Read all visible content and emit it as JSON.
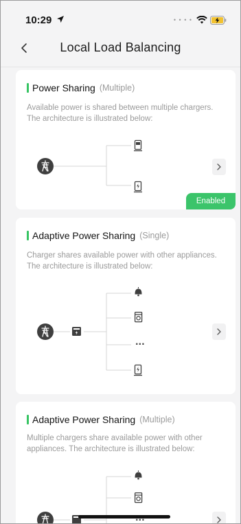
{
  "status_bar": {
    "time": "10:29",
    "icons": [
      "location-arrow-icon",
      "signal-dots-icon",
      "wifi-icon",
      "battery-charging-icon"
    ]
  },
  "nav": {
    "back_icon": "chevron-left-icon",
    "title": "Local Load Balancing"
  },
  "cards": [
    {
      "title": "Power Sharing",
      "subtitle": "(Multiple)",
      "description": "Available power is shared between multiple chargers. The architecture is illustrated below:",
      "badge": "Enabled",
      "diagram_nodes": [
        "grid-tower-icon",
        "charger-icon",
        "charger-icon"
      ]
    },
    {
      "title": "Adaptive Power Sharing",
      "subtitle": "(Single)",
      "description": "Charger shares available power with other appliances. The architecture is illustrated below:",
      "diagram_nodes": [
        "grid-tower-icon",
        "meter-icon",
        "lamp-icon",
        "washing-machine-icon",
        "ellipsis-icon",
        "charger-icon"
      ],
      "ellipsis": "···"
    },
    {
      "title": "Adaptive Power Sharing",
      "subtitle": "(Multiple)",
      "description": "Multiple chargers share available power with other appliances. The architecture is illustrated below:",
      "diagram_nodes": [
        "grid-tower-icon",
        "meter-icon",
        "lamp-icon",
        "washing-machine-icon",
        "ellipsis-icon"
      ],
      "ellipsis": "···"
    }
  ],
  "colors": {
    "accent_green": "#37c463",
    "badge_green": "#3bc46a",
    "icon_dark": "#3f3f3f",
    "line_gray": "#d4d4d4",
    "muted_text": "#9a9a9a"
  }
}
